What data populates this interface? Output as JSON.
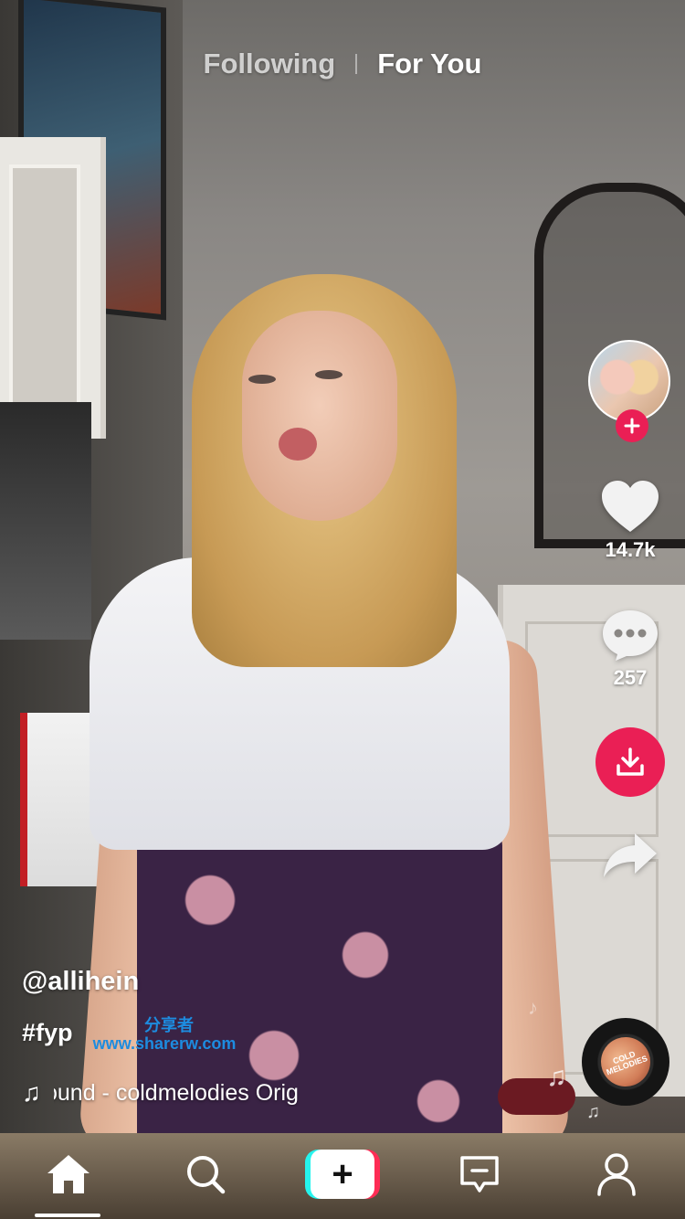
{
  "top_tabs": {
    "following": "Following",
    "for_you": "For You"
  },
  "video": {
    "username": "@allihein",
    "caption": "#fyp",
    "music_text": "ound - coldmelodies    Orig",
    "disc_label": "COLD MELODIES"
  },
  "actions": {
    "like_count": "14.7k",
    "comment_count": "257"
  },
  "watermark": {
    "cn": "分享者",
    "url": "www.sharerw.com"
  },
  "bottom_nav": {
    "items": [
      "home-icon",
      "search-icon",
      "create-button",
      "inbox-icon",
      "profile-icon"
    ],
    "create_symbol": "+"
  },
  "colors": {
    "accent": "#ea1f55",
    "cyan": "#25f4ee",
    "red": "#fe2c55",
    "watermark": "#1d8ce0"
  }
}
